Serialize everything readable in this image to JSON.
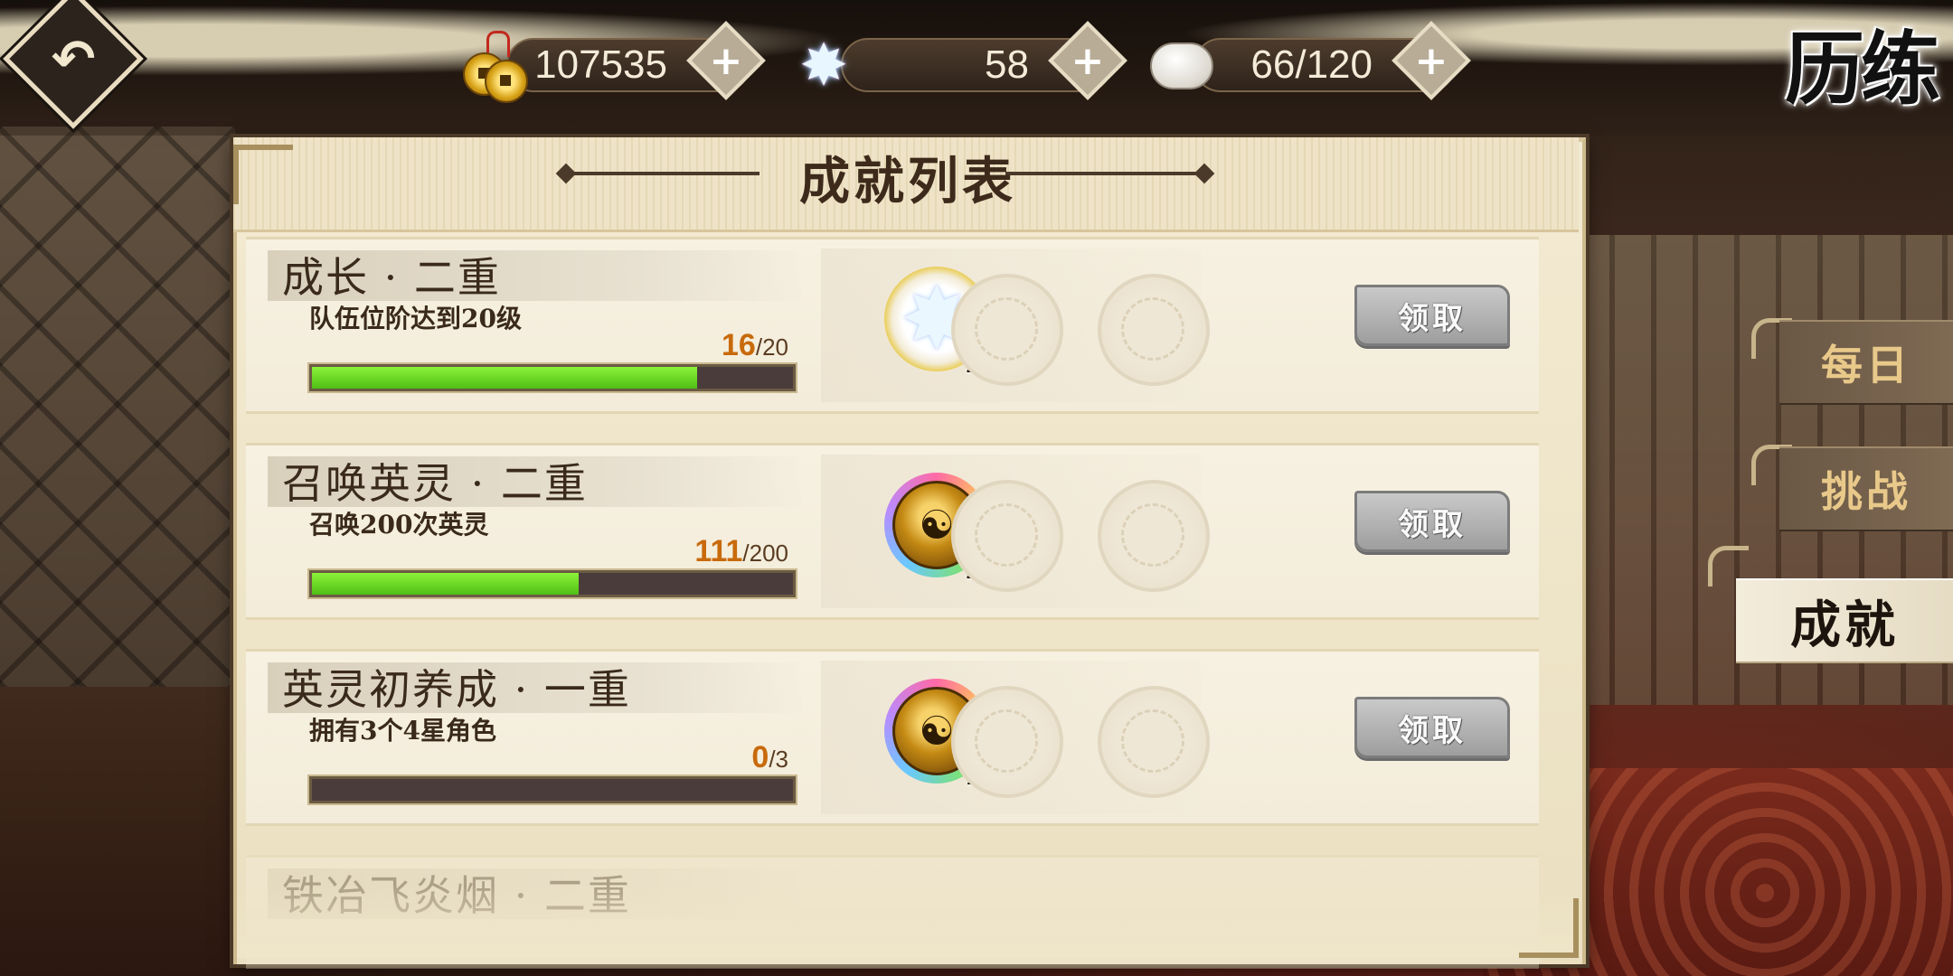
{
  "header": {
    "title": "历练",
    "back_icon": "back-arrow-icon"
  },
  "currencies": [
    {
      "icon": "coin-icon",
      "value": "107535"
    },
    {
      "icon": "star-crystal-icon",
      "value": "58"
    },
    {
      "icon": "steamed-bun-icon",
      "value": "66/120"
    }
  ],
  "panel": {
    "title": "成就列表"
  },
  "achievements": [
    {
      "name": "成长 · 二重",
      "desc": "队伍位阶达到20级",
      "current": "16",
      "max": "/20",
      "progress": 0.8,
      "reward": {
        "icon": "star-crystal-icon",
        "count": "20"
      },
      "claim": "领取"
    },
    {
      "name": "召唤英灵 · 二重",
      "desc": "召唤200次英灵",
      "current": "111",
      "max": "/200",
      "progress": 0.555,
      "reward": {
        "icon": "summon-medal-icon",
        "count": "2"
      },
      "claim": "领取"
    },
    {
      "name": "英灵初养成 · 一重",
      "desc": "拥有3个4星角色",
      "current": "0",
      "max": "/3",
      "progress": 0,
      "reward": {
        "icon": "summon-medal-icon",
        "count": "1"
      },
      "claim": "领取"
    },
    {
      "name": "铁冶飞炎烟 · 二重"
    }
  ],
  "tabs": [
    {
      "label": "每日",
      "active": false
    },
    {
      "label": "挑战",
      "active": false
    },
    {
      "label": "成就",
      "active": true
    }
  ],
  "colors": {
    "progress_fill": "#6fd82a",
    "progress_current": "#c86a0c",
    "claim_disabled": "#a9a9a9",
    "tab_inactive_text": "#e9c98a"
  }
}
